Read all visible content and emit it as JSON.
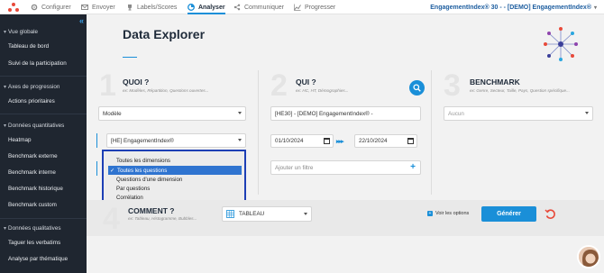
{
  "topnav": {
    "items": [
      {
        "label": "Configurer",
        "icon": "gear-icon"
      },
      {
        "label": "Envoyer",
        "icon": "envelope-icon"
      },
      {
        "label": "Labels/Scores",
        "icon": "trophy-icon"
      },
      {
        "label": "Analyser",
        "icon": "chart-pie-icon"
      },
      {
        "label": "Communiquer",
        "icon": "share-icon"
      },
      {
        "label": "Progresser",
        "icon": "trend-icon"
      }
    ],
    "account": "EngagementIndex® 30 - - [DEMO] EngagementIndex®"
  },
  "sidebar": {
    "sections": [
      {
        "title": "Vue globale",
        "items": [
          "Tableau de bord",
          "Suivi de la participation"
        ]
      },
      {
        "title": "Axes de progression",
        "items": [
          "Actions prioritaires"
        ]
      },
      {
        "title": "Données quantitatives",
        "items": [
          "Heatmap",
          "Benchmark externe",
          "Benchmark interne",
          "Benchmark historique",
          "Benchmark custom"
        ]
      },
      {
        "title": "Données qualitatives",
        "items": [
          "Taguer les verbatims",
          "Analyse par thématique"
        ]
      }
    ]
  },
  "main": {
    "title": "Data Explorer",
    "quoi": {
      "number": "1",
      "title": "QUOI ?",
      "subtitle": "ex: Modèles, Répartition, Questions ouvertes...",
      "model_select": "Modèle",
      "index_select": "[HE] EngagementIndex®",
      "dropdown_options": [
        "Toutes les dimensions",
        "Toutes les questions",
        "Questions d'une dimension",
        "Par questions",
        "Corrélation"
      ],
      "selected_option": "Toutes les questions"
    },
    "qui": {
      "number": "2",
      "title": "QUI ?",
      "subtitle": "ex: HC, HT, Démographies...",
      "population_select": "[HE30] - [DEMO] EngagementIndex® -",
      "date_from": "01/10/2024",
      "date_to": "22/10/2024",
      "filter_placeholder": "Ajouter un filtre"
    },
    "benchmark": {
      "number": "3",
      "title": "BENCHMARK",
      "subtitle": "ex: Genre, Secteur, Taille, Pays, Question spécifique...",
      "select": "Aucun"
    },
    "comment": {
      "number": "4",
      "title": "COMMENT ?",
      "subtitle": "ex: Tableau, Histogramme, Bubbles...",
      "format_select": "TABLEAU",
      "options_label": "Voir les options",
      "generate_label": "Générer"
    }
  },
  "colors": {
    "accent": "#1a8fd8",
    "sidebar_bg": "#1f2630",
    "dropdown_border": "#1d3fb5",
    "selected_bg": "#2f74d0"
  }
}
